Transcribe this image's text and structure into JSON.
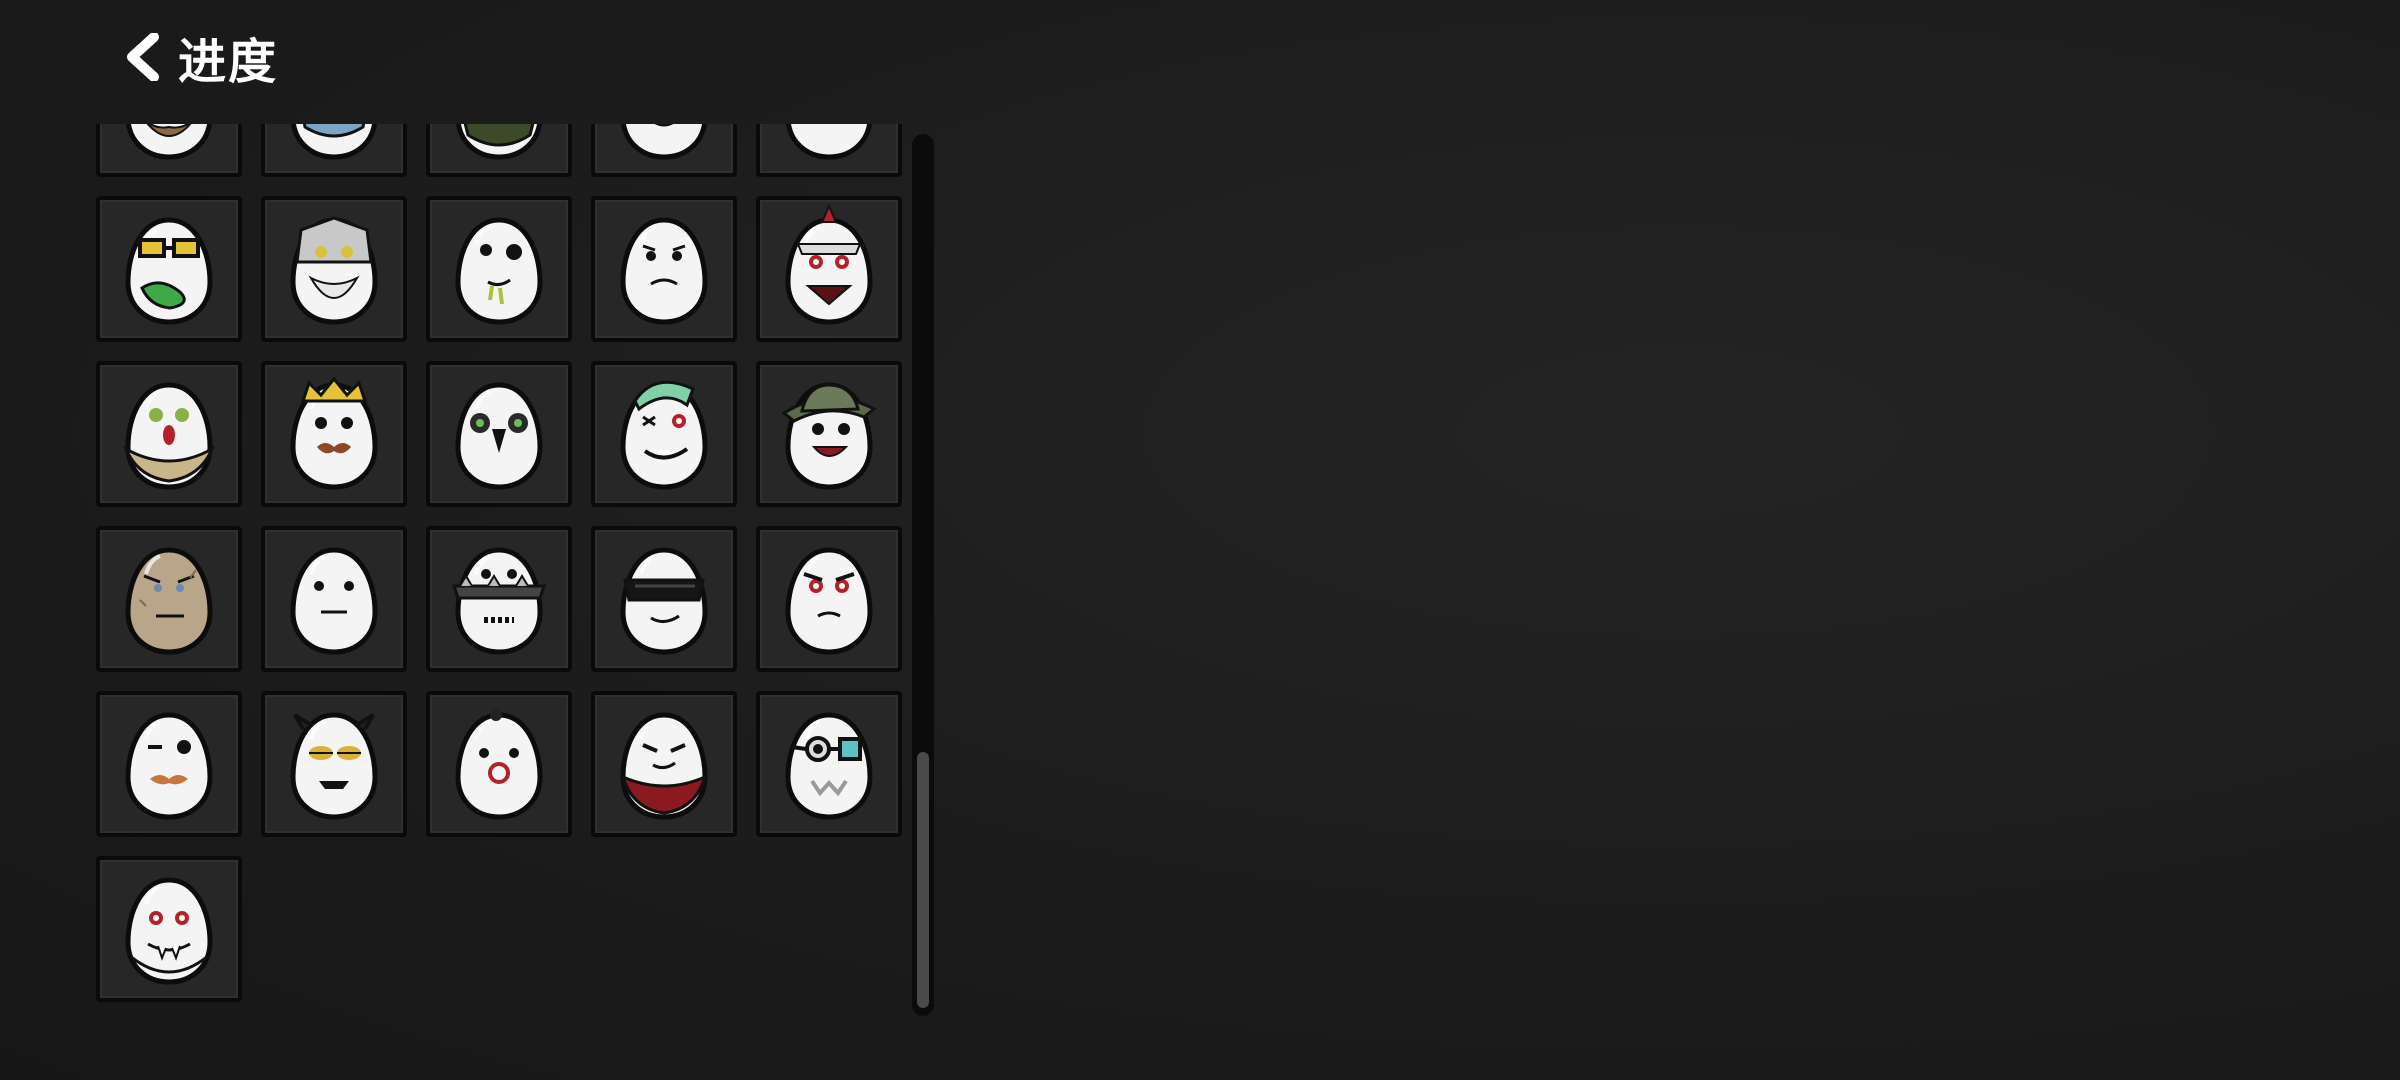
{
  "header": {
    "title": "进度",
    "back_icon": "chevron-left-icon"
  },
  "grid": {
    "items": [
      {
        "name": "bearded-egg",
        "face": "beard"
      },
      {
        "name": "masked-egg",
        "face": "mask"
      },
      {
        "name": "bandana-egg",
        "face": "bandana"
      },
      {
        "name": "grinning-egg",
        "face": "grin"
      },
      {
        "name": "mustache-egg",
        "face": "mustache"
      },
      {
        "name": "glasses-egg",
        "face": "glasses"
      },
      {
        "name": "armored-bearded-egg",
        "face": "helmet"
      },
      {
        "name": "drooling-egg",
        "face": "drool"
      },
      {
        "name": "worried-egg",
        "face": "worried"
      },
      {
        "name": "horned-egg",
        "face": "horned"
      },
      {
        "name": "scarf-egg",
        "face": "scarf"
      },
      {
        "name": "king-egg",
        "face": "king"
      },
      {
        "name": "crow-egg",
        "face": "crow"
      },
      {
        "name": "mohawk-egg",
        "face": "mohawk"
      },
      {
        "name": "hat-egg",
        "face": "hat"
      },
      {
        "name": "stone-egg",
        "face": "stone"
      },
      {
        "name": "blank-egg",
        "face": "blank"
      },
      {
        "name": "spiked-egg",
        "face": "spiked"
      },
      {
        "name": "visor-egg",
        "face": "visor"
      },
      {
        "name": "angry-egg",
        "face": "angry"
      },
      {
        "name": "mustache-wink-egg",
        "face": "wink"
      },
      {
        "name": "sleepy-horned-egg",
        "face": "sleepy"
      },
      {
        "name": "ring-nose-egg",
        "face": "ring"
      },
      {
        "name": "red-scarf-egg",
        "face": "redscarf"
      },
      {
        "name": "goggles-egg",
        "face": "goggles"
      },
      {
        "name": "vampire-egg",
        "face": "vampire"
      }
    ]
  },
  "scrollbar": {
    "position": 0.72,
    "visible_fraction": 0.29
  },
  "colors": {
    "background": "#1c1c1c",
    "cell": "#272727",
    "cell_border": "#0a0a0a",
    "egg": "#f4f4f4",
    "text": "#ffffff"
  }
}
